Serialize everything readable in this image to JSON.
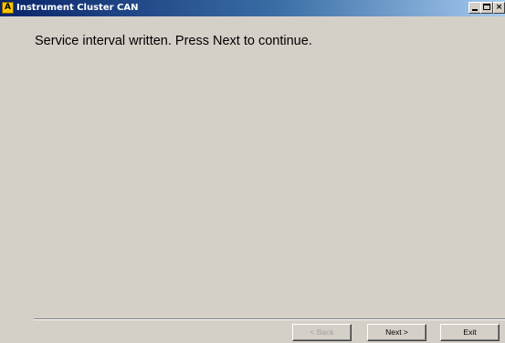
{
  "window": {
    "title": "Instrument Cluster CAN",
    "app_icon_letter": "A",
    "controls": {
      "minimize": "minimize",
      "maximize": "maximize",
      "close_label": "×"
    }
  },
  "main": {
    "message": "Service interval written. Press Next to continue."
  },
  "footer": {
    "back_label": "< Back",
    "back_enabled": false,
    "next_label": "Next >",
    "exit_label": "Exit"
  },
  "colors": {
    "face": "#d4d0c8",
    "title_active": "#0a246a",
    "disabled_text": "#a0a0a0"
  }
}
